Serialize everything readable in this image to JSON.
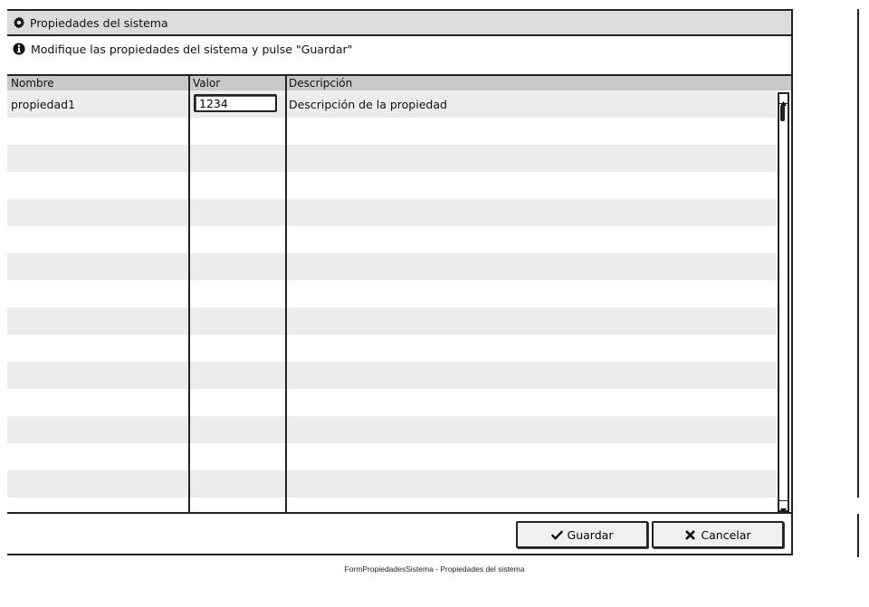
{
  "window": {
    "title": "Propiedades del sistema",
    "title_icon": "gear-icon"
  },
  "info": {
    "icon": "info-icon",
    "message": "Modifique las propiedades del sistema y pulse \"Guardar\""
  },
  "table": {
    "columns": [
      "Nombre",
      "Valor",
      "Descripción"
    ],
    "rows": [
      {
        "name": "propiedad1",
        "value": "1234",
        "description": "Descripción de la propiedad"
      }
    ]
  },
  "buttons": {
    "save_label": "Guardar",
    "save_icon": "check-icon",
    "cancel_label": "Cancelar",
    "cancel_icon": "x-icon"
  },
  "caption": "FormPropiedadesSistema - Propiedades del sistema"
}
